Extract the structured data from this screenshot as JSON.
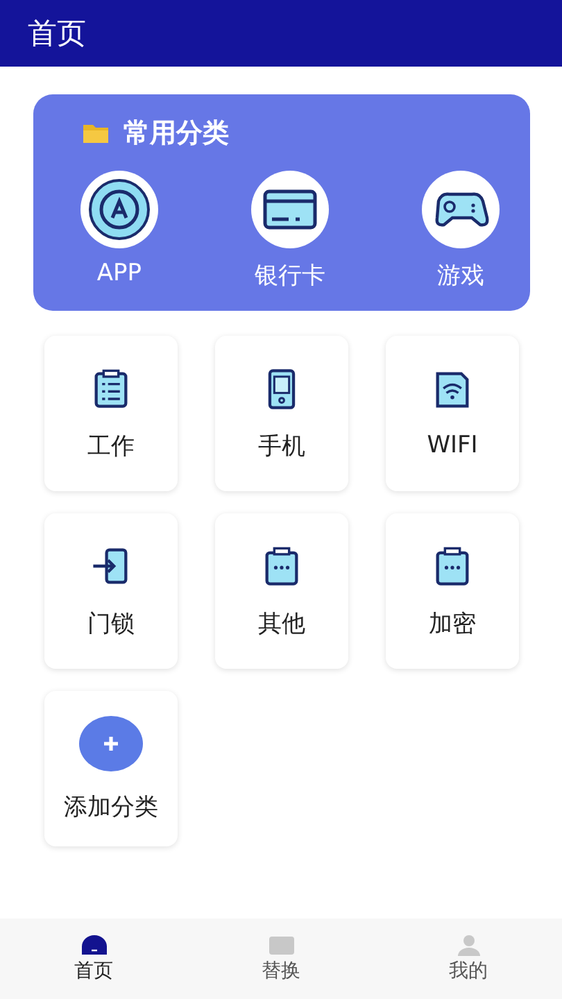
{
  "header": {
    "title": "首页"
  },
  "common": {
    "title": "常用分类",
    "items": [
      {
        "label": "APP"
      },
      {
        "label": "银行卡"
      },
      {
        "label": "游戏"
      }
    ]
  },
  "categories": [
    {
      "kind": "category",
      "label": "工作"
    },
    {
      "kind": "category",
      "label": "手机"
    },
    {
      "kind": "category",
      "label": "WIFI"
    },
    {
      "kind": "category",
      "label": "门锁"
    },
    {
      "kind": "category",
      "label": "其他"
    },
    {
      "kind": "category",
      "label": "加密"
    },
    {
      "kind": "add",
      "label": "添加分类"
    }
  ],
  "bottom_nav": [
    {
      "label": "首页",
      "selected": true
    },
    {
      "label": "替换",
      "selected": false
    },
    {
      "label": "我的",
      "selected": false
    }
  ]
}
